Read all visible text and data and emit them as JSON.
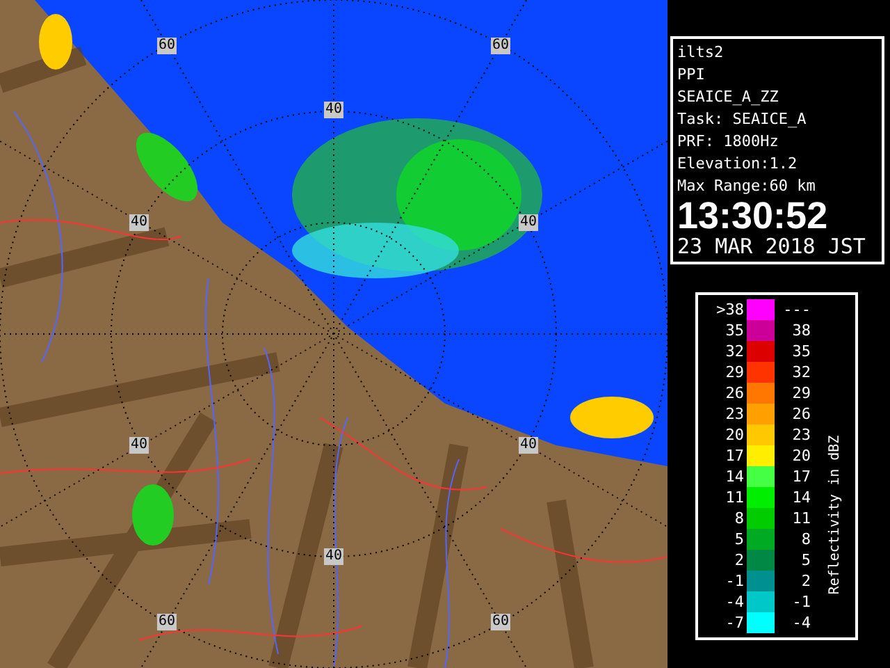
{
  "map": {
    "range_labels": [
      "60",
      "60",
      "40",
      "40",
      "40",
      "40",
      "40",
      "40",
      "60",
      "60"
    ]
  },
  "info_panel": {
    "lines": [
      "ilts2",
      "PPI",
      "SEAICE_A_ZZ",
      "Task: SEAICE_A",
      "PRF: 1800Hz",
      "Elevation:1.2",
      "Max Range:60 km"
    ],
    "time": "13:30:52",
    "date": "23 MAR 2018 JST"
  },
  "legend": {
    "axis_label": "Reflectivity in dBZ",
    "rows": [
      {
        "low": ">38",
        "high": "---",
        "color": "#ff00ff"
      },
      {
        "low": "35",
        "high": "38",
        "color": "#cc0099"
      },
      {
        "low": "32",
        "high": "35",
        "color": "#dd0000"
      },
      {
        "low": "29",
        "high": "32",
        "color": "#ff3300"
      },
      {
        "low": "26",
        "high": "29",
        "color": "#ff7700"
      },
      {
        "low": "23",
        "high": "26",
        "color": "#ffa000"
      },
      {
        "low": "20",
        "high": "23",
        "color": "#ffc800"
      },
      {
        "low": "17",
        "high": "20",
        "color": "#ffee00"
      },
      {
        "low": "14",
        "high": "17",
        "color": "#44ff44"
      },
      {
        "low": "11",
        "high": "14",
        "color": "#00ee00"
      },
      {
        "low": "8",
        "high": "11",
        "color": "#00cc00"
      },
      {
        "low": "5",
        "high": "8",
        "color": "#00aa22"
      },
      {
        "low": "2",
        "high": "5",
        "color": "#008844"
      },
      {
        "low": "-1",
        "high": "2",
        "color": "#009090"
      },
      {
        "low": "-4",
        "high": "-1",
        "color": "#00c8c8"
      },
      {
        "low": "-7",
        "high": "-4",
        "color": "#00ffff"
      }
    ]
  }
}
